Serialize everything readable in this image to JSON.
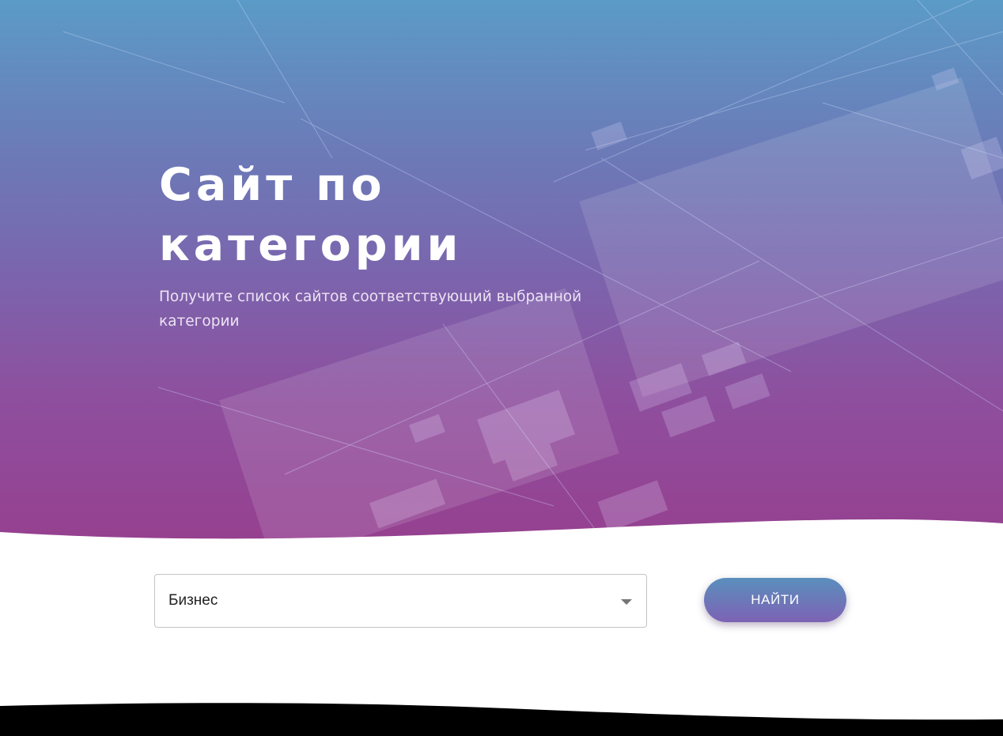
{
  "hero": {
    "title": "Сайт по категории",
    "subtitle": "Получите список сайтов соответствующий выбранной категории"
  },
  "form": {
    "category_selected": "Бизнес",
    "search_label": "НАЙТИ"
  },
  "colors": {
    "hero_gradient_top": "#5b9bc7",
    "hero_gradient_bottom": "#963f8e",
    "button_gradient_top": "#5a8fbd",
    "button_gradient_bottom": "#7d62b4",
    "footer": "#000000"
  },
  "icons": {
    "select_arrow": "caret-down-icon"
  }
}
